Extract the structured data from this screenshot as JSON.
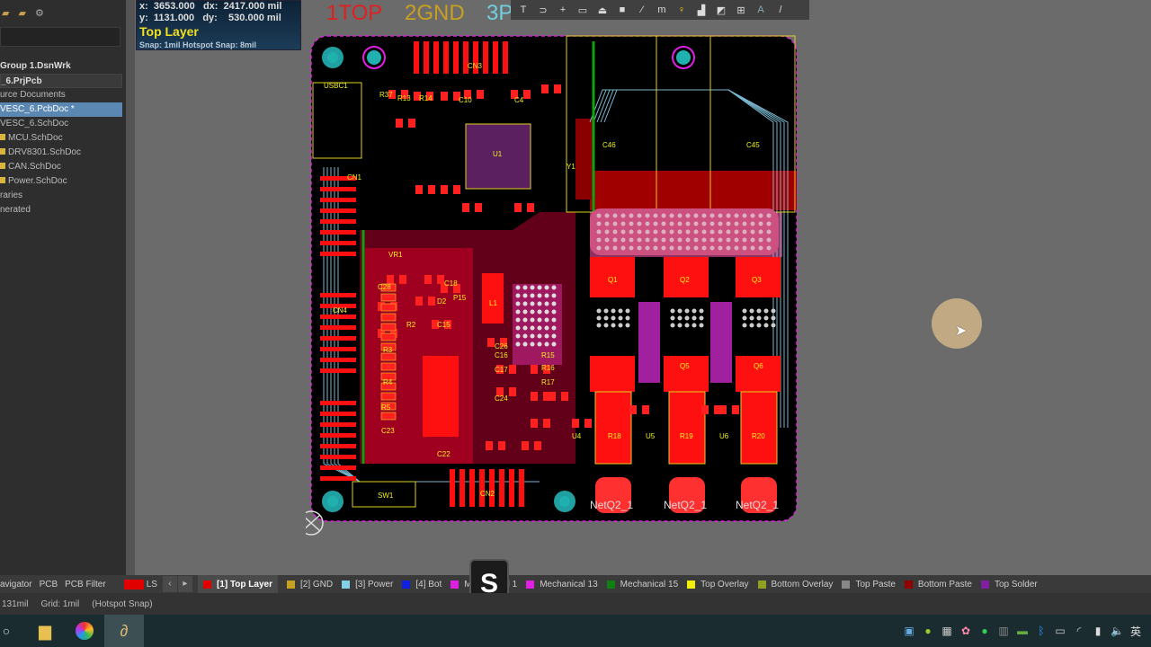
{
  "left_panel": {
    "toolbar_icons": [
      "folder-open-icon",
      "folder-icon",
      "gear-icon"
    ],
    "tree": [
      {
        "label": "Group 1.DsnWrk",
        "style": "b"
      },
      {
        "label": "_6.PrjPcb",
        "style": "b proj"
      },
      {
        "label": "urce Documents",
        "style": ""
      },
      {
        "label": "VESC_6.PcbDoc *",
        "style": "sel"
      },
      {
        "label": "VESC_6.SchDoc",
        "style": ""
      },
      {
        "label": "MCU.SchDoc",
        "style": "f"
      },
      {
        "label": "DRV8301.SchDoc",
        "style": "f"
      },
      {
        "label": "CAN.SchDoc",
        "style": "f"
      },
      {
        "label": "Power.SchDoc",
        "style": "f"
      },
      {
        "label": "raries",
        "style": ""
      },
      {
        "label": "nerated",
        "style": ""
      }
    ]
  },
  "coord_hud": {
    "x": "x:  3653.000   dx:  2417.000 mil",
    "y": "y:  1131.000   dy:    530.000 mil",
    "layer": "Top Layer",
    "snap": "Snap: 1mil Hotspot Snap: 8mil"
  },
  "layer_names": [
    {
      "text": "1TOP",
      "color": "#e02020"
    },
    {
      "text": "2GND",
      "color": "#c8a020"
    },
    {
      "text": "3P",
      "color": "#70d0e0"
    }
  ],
  "toolbar_icons": [
    "T",
    "⊃",
    "+",
    "▭",
    "⏏",
    "■",
    "⁄",
    "m",
    "♀",
    "▟",
    "◩",
    "⊞",
    "A",
    "/"
  ],
  "pcb": {
    "labels": [
      "CN3",
      "USBC1",
      "R37",
      "R13",
      "R14",
      "C10",
      "C4",
      "U1",
      "C46",
      "C45",
      "CN1",
      "VR1",
      "C28",
      "C18",
      "L1",
      "D2",
      "C15",
      "P15",
      "R2",
      "R3",
      "R4",
      "R5",
      "C23",
      "C26",
      "CN4",
      "C16",
      "C17",
      "C24",
      "R15",
      "R16",
      "R17",
      "Y1",
      "Q1",
      "Q2",
      "Q3",
      "Q5",
      "Q6",
      "U4",
      "U5",
      "U6",
      "R18",
      "R19",
      "R20",
      "C22",
      "SW1",
      "CN2",
      "NetQ2_1",
      "NetQ2_1",
      "NetQ2_1"
    ]
  },
  "layer_bar": {
    "panel_tabs": [
      "avigator",
      "PCB",
      "PCB Filter"
    ],
    "ls_label": "LS",
    "layers": [
      {
        "label": "[1] Top Layer",
        "color": "#e00000",
        "active": true
      },
      {
        "label": "[2] GND",
        "color": "#c8a020"
      },
      {
        "label": "[3] Power",
        "color": "#80d0e8"
      },
      {
        "label": "[4] Bot",
        "color": "#1020e0"
      },
      {
        "label": "Mechanical 1",
        "color": "#e020e0"
      },
      {
        "label": "Mechanical 13",
        "color": "#e020e0"
      },
      {
        "label": "Mechanical 15",
        "color": "#108010"
      },
      {
        "label": "Top Overlay",
        "color": "#f0f000"
      },
      {
        "label": "Bottom Overlay",
        "color": "#90a020"
      },
      {
        "label": "Top Paste",
        "color": "#888888"
      },
      {
        "label": "Bottom Paste",
        "color": "#900000"
      },
      {
        "label": "Top Solder",
        "color": "#8020a0"
      }
    ]
  },
  "status": {
    "pos": "131mil",
    "grid": "Grid: 1mil",
    "snap": "(Hotspot Snap)"
  },
  "key_overlay": "S",
  "taskbar": {
    "icons": [
      "search-icon",
      "file-explorer-icon",
      "chrome-icon",
      "altium-icon"
    ],
    "tray_icons": [
      "network-icon",
      "app-icon",
      "qr-icon",
      "flower-icon",
      "wechat-icon",
      "tablet-icon",
      "nvidia-icon",
      "bluetooth-icon",
      "battery-icon",
      "wifi-icon",
      "mic-icon",
      "volume-icon"
    ],
    "ime": "英"
  }
}
